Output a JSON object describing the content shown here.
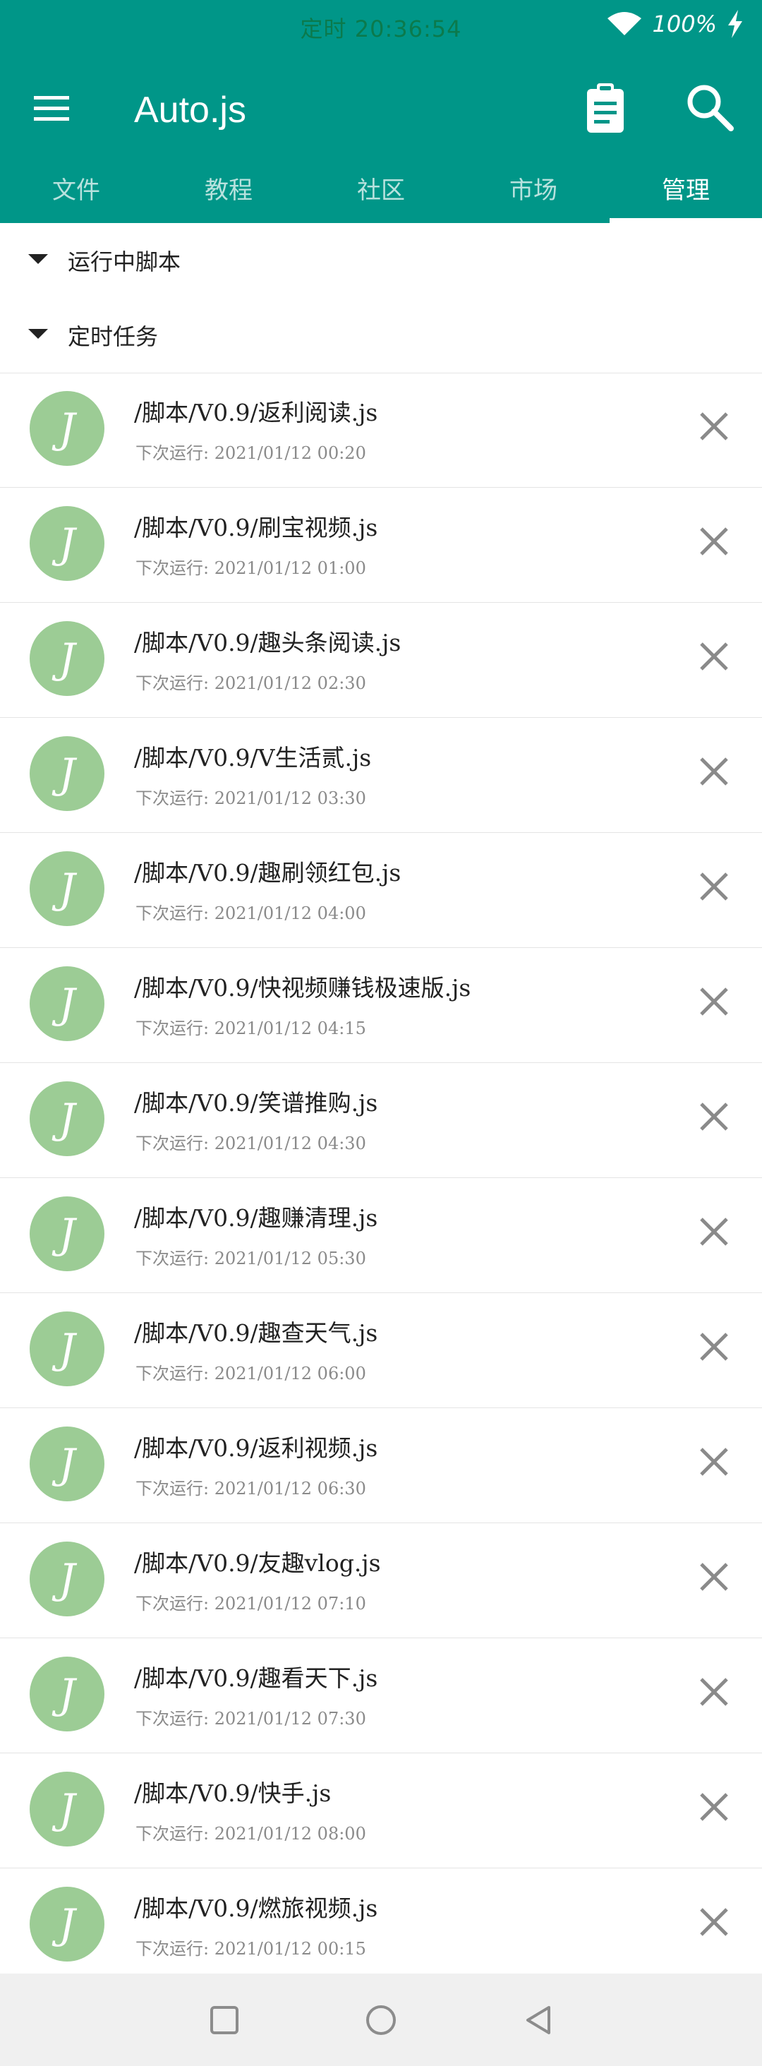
{
  "status": {
    "time": "定时 20:36:54",
    "battery": "100%"
  },
  "toolbar": {
    "title": "Auto.js",
    "menu_icon": "menu-icon",
    "clipboard_icon": "clipboard-icon",
    "search_icon": "search-icon"
  },
  "tabs": [
    {
      "label": "文件",
      "active": false
    },
    {
      "label": "教程",
      "active": false
    },
    {
      "label": "社区",
      "active": false
    },
    {
      "label": "市场",
      "active": false
    },
    {
      "label": "管理",
      "active": true
    }
  ],
  "sections": {
    "running": "运行中脚本",
    "scheduled": "定时任务"
  },
  "tasks": [
    {
      "avatar": "J",
      "path": "/脚本/V0.9/返利阅读.js",
      "next_run": "下次运行: 2021/01/12 00:20"
    },
    {
      "avatar": "J",
      "path": "/脚本/V0.9/刷宝视频.js",
      "next_run": "下次运行: 2021/01/12 01:00"
    },
    {
      "avatar": "J",
      "path": "/脚本/V0.9/趣头条阅读.js",
      "next_run": "下次运行: 2021/01/12 02:30"
    },
    {
      "avatar": "J",
      "path": "/脚本/V0.9/V生活贰.js",
      "next_run": "下次运行: 2021/01/12 03:30"
    },
    {
      "avatar": "J",
      "path": "/脚本/V0.9/趣刷领红包.js",
      "next_run": "下次运行: 2021/01/12 04:00"
    },
    {
      "avatar": "J",
      "path": "/脚本/V0.9/快视频赚钱极速版.js",
      "next_run": "下次运行: 2021/01/12 04:15"
    },
    {
      "avatar": "J",
      "path": "/脚本/V0.9/笑谱推购.js",
      "next_run": "下次运行: 2021/01/12 04:30"
    },
    {
      "avatar": "J",
      "path": "/脚本/V0.9/趣赚清理.js",
      "next_run": "下次运行: 2021/01/12 05:30"
    },
    {
      "avatar": "J",
      "path": "/脚本/V0.9/趣查天气.js",
      "next_run": "下次运行: 2021/01/12 06:00"
    },
    {
      "avatar": "J",
      "path": "/脚本/V0.9/返利视频.js",
      "next_run": "下次运行: 2021/01/12 06:30"
    },
    {
      "avatar": "J",
      "path": "/脚本/V0.9/友趣vlog.js",
      "next_run": "下次运行: 2021/01/12 07:10"
    },
    {
      "avatar": "J",
      "path": "/脚本/V0.9/趣看天下.js",
      "next_run": "下次运行: 2021/01/12 07:30"
    },
    {
      "avatar": "J",
      "path": "/脚本/V0.9/快手.js",
      "next_run": "下次运行: 2021/01/12 08:00"
    },
    {
      "avatar": "J",
      "path": "/脚本/V0.9/燃旅视频.js",
      "next_run": "下次运行: 2021/01/12 00:15"
    }
  ],
  "navbar": {
    "recent_icon": "square-recents-icon",
    "home_icon": "circle-home-icon",
    "back_icon": "triangle-back-icon"
  },
  "colors": {
    "primary": "#009688",
    "avatar": "#9ccc95",
    "close": "#8a8a8a"
  }
}
